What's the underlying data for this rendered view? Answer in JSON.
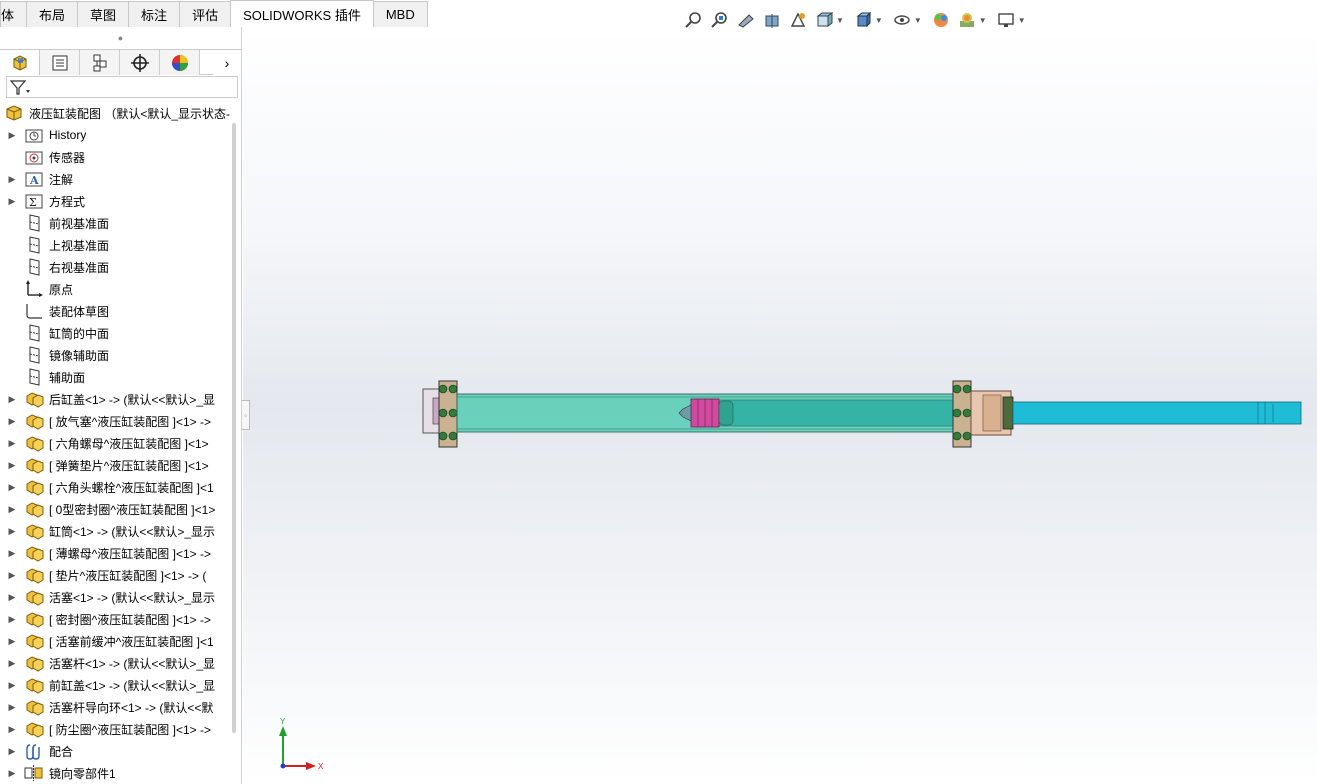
{
  "ribbon": {
    "tabs": [
      "体",
      "布局",
      "草图",
      "标注",
      "评估",
      "SOLIDWORKS 插件",
      "MBD"
    ]
  },
  "hud_icons": [
    "zoom-to-fit-icon",
    "zoom-to-area-icon",
    "previous-view-icon",
    "section-view-icon",
    "dynamic-annotation-icon",
    "view-orientation-icon",
    "display-style-icon",
    "hide-show-icon",
    "edit-appearance-icon",
    "apply-scene-icon",
    "view-settings-icon"
  ],
  "panel_tabs": [
    "feature-manager-icon",
    "property-manager-icon",
    "configuration-manager-icon",
    "dimxpert-manager-icon",
    "display-manager-icon"
  ],
  "tree": {
    "root": "液压缸装配图 （默认<默认_显示状态-",
    "items": [
      {
        "label": "History",
        "icon": "history-folder-icon",
        "expand": true
      },
      {
        "label": "传感器",
        "icon": "sensor-icon",
        "expand": false
      },
      {
        "label": "注解",
        "icon": "annotation-icon",
        "expand": true
      },
      {
        "label": "方程式",
        "icon": "equation-icon",
        "expand": true
      },
      {
        "label": "前视基准面",
        "icon": "plane-icon",
        "expand": false
      },
      {
        "label": "上视基准面",
        "icon": "plane-icon",
        "expand": false
      },
      {
        "label": "右视基准面",
        "icon": "plane-icon",
        "expand": false
      },
      {
        "label": "原点",
        "icon": "origin-icon",
        "expand": false
      },
      {
        "label": "装配体草图",
        "icon": "sketch-icon",
        "expand": false
      },
      {
        "label": "缸筒的中面",
        "icon": "plane-icon",
        "expand": false
      },
      {
        "label": "镜像辅助面",
        "icon": "plane-icon",
        "expand": false
      },
      {
        "label": "辅助面",
        "icon": "plane-icon",
        "expand": false
      },
      {
        "label": "后缸盖<1> -> (默认<<默认>_显",
        "icon": "part-icon",
        "expand": true
      },
      {
        "label": "[ 放气塞^液压缸装配图 ]<1> ->",
        "icon": "part-icon",
        "expand": true
      },
      {
        "label": "[ 六角螺母^液压缸装配图 ]<1>",
        "icon": "part-icon",
        "expand": true
      },
      {
        "label": "[ 弹簧垫片^液压缸装配图 ]<1>",
        "icon": "part-icon",
        "expand": true
      },
      {
        "label": "[ 六角头螺栓^液压缸装配图 ]<1",
        "icon": "part-icon",
        "expand": true
      },
      {
        "label": "[ 0型密封圈^液压缸装配图 ]<1>",
        "icon": "part-icon",
        "expand": true
      },
      {
        "label": "缸筒<1> -> (默认<<默认>_显示",
        "icon": "part-icon",
        "expand": true
      },
      {
        "label": "[ 薄螺母^液压缸装配图 ]<1> ->",
        "icon": "part-icon",
        "expand": true
      },
      {
        "label": "[ 垫片^液压缸装配图 ]<1> -> (",
        "icon": "part-icon",
        "expand": true
      },
      {
        "label": "活塞<1> -> (默认<<默认>_显示",
        "icon": "part-icon",
        "expand": true
      },
      {
        "label": "[ 密封圈^液压缸装配图 ]<1> ->",
        "icon": "part-icon",
        "expand": true
      },
      {
        "label": "[ 活塞前缓冲^液压缸装配图 ]<1",
        "icon": "part-icon",
        "expand": true
      },
      {
        "label": "活塞杆<1> -> (默认<<默认>_显",
        "icon": "part-icon",
        "expand": true
      },
      {
        "label": "前缸盖<1> -> (默认<<默认>_显",
        "icon": "part-icon",
        "expand": true
      },
      {
        "label": "活塞杆导向环<1> -> (默认<<默",
        "icon": "part-icon",
        "expand": true
      },
      {
        "label": "[ 防尘圈^液压缸装配图 ]<1> ->",
        "icon": "part-icon",
        "expand": true
      },
      {
        "label": "配合",
        "icon": "mates-icon",
        "expand": true
      },
      {
        "label": "镜向零部件1",
        "icon": "mirror-component-icon",
        "expand": true
      }
    ]
  },
  "triad": {
    "x_label": "X",
    "y_label": "Y"
  },
  "colors": {
    "cylinder": "#5fcfb8",
    "rod": "#1fbcd8",
    "flange": "#c9b28f",
    "piston": "#d24aa0"
  }
}
